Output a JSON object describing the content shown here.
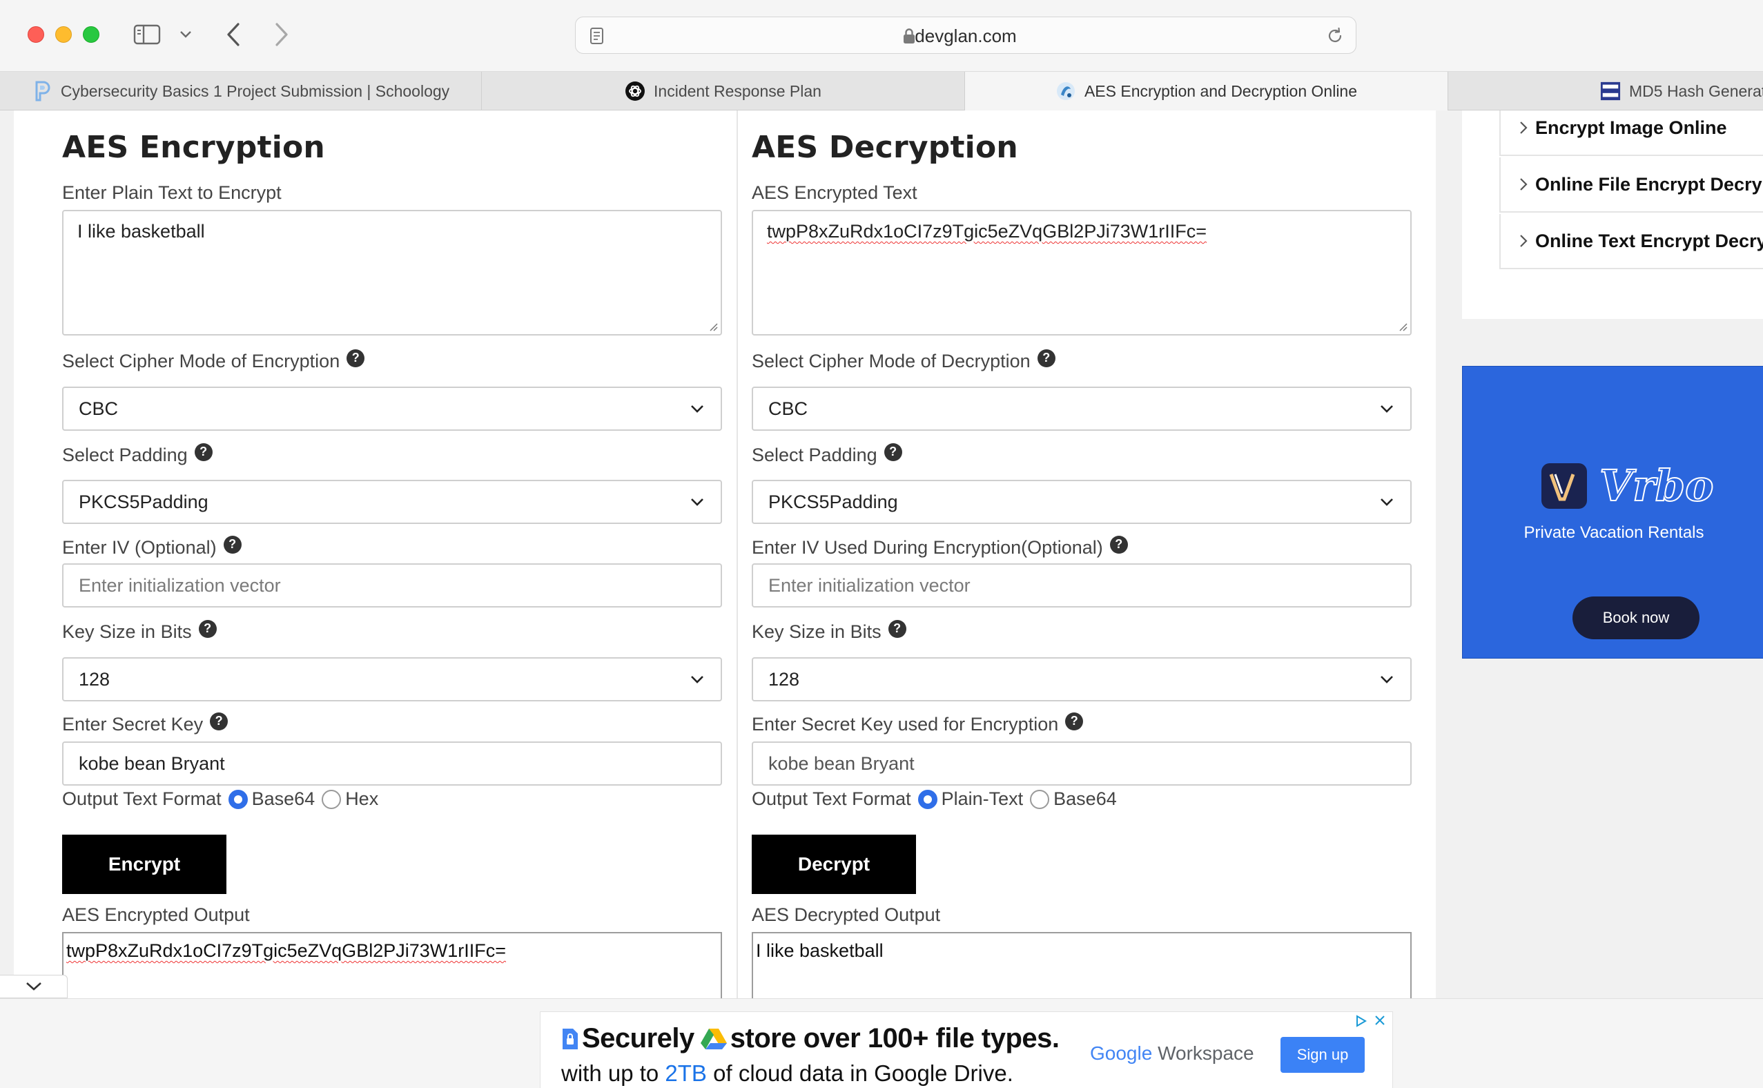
{
  "browser": {
    "url": "devglan.com",
    "tabs": [
      {
        "title": "Cybersecurity Basics 1 Project Submission | Schoology"
      },
      {
        "title": "Incident Response Plan"
      },
      {
        "title": "AES Encryption and Decryption Online"
      },
      {
        "title": "MD5 Hash Generat"
      }
    ]
  },
  "encrypt": {
    "title": "AES Encryption",
    "plain_label": "Enter Plain Text to Encrypt",
    "plain_value": "I like basketball",
    "mode_label": "Select Cipher Mode of Encryption",
    "mode_value": "CBC",
    "padding_label": "Select Padding",
    "padding_value": "PKCS5Padding",
    "iv_label": "Enter IV (Optional)",
    "iv_placeholder": "Enter initialization vector",
    "keysize_label": "Key Size in Bits",
    "keysize_value": "128",
    "key_label": "Enter Secret Key",
    "key_value": "kobe bean Bryant",
    "format_label": "Output Text Format",
    "format_opt1": "Base64",
    "format_opt2": "Hex",
    "button": "Encrypt",
    "output_label": "AES Encrypted Output",
    "output_value": "twpP8xZuRdx1oCI7z9Tgic5eZVqGBl2PJi73W1rIIFc="
  },
  "decrypt": {
    "title": "AES Decryption",
    "cipher_label": "AES Encrypted Text",
    "cipher_value": "twpP8xZuRdx1oCI7z9Tgic5eZVqGBl2PJi73W1rIIFc=",
    "mode_label": "Select Cipher Mode of Decryption",
    "mode_value": "CBC",
    "padding_label": "Select Padding",
    "padding_value": "PKCS5Padding",
    "iv_label": "Enter IV Used During Encryption(Optional)",
    "iv_placeholder": "Enter initialization vector",
    "keysize_label": "Key Size in Bits",
    "keysize_value": "128",
    "key_label": "Enter Secret Key used for Encryption",
    "key_value": "kobe bean Bryant",
    "format_label": "Output Text Format",
    "format_opt1": "Plain-Text",
    "format_opt2": "Base64",
    "button": "Decrypt",
    "output_label": "AES Decrypted Output",
    "output_value": "I like basketball"
  },
  "help_glyph": "?",
  "sidebar": {
    "links": [
      {
        "label": "Encrypt Image Online"
      },
      {
        "label": "Online File Encrypt Decrypt"
      },
      {
        "label": "Online Text Encrypt Decryp"
      }
    ]
  },
  "ad_vrbo": {
    "brand": "Vrbo",
    "tagline": "Private Vacation Rentals",
    "button": "Book now"
  },
  "ad_google": {
    "line1_a": "Securely",
    "line1_b": "store over 100+ file types.",
    "line2_a": "with up to",
    "line2_hl": "2TB",
    "line2_b": "of cloud data in Google Drive.",
    "brand_g": "Google",
    "brand_w": "Workspace",
    "button": "Sign up"
  },
  "colors": {
    "accent_blue": "#2f6ee8",
    "vrbo_blue": "#2b66dd",
    "button_black": "#000000"
  }
}
